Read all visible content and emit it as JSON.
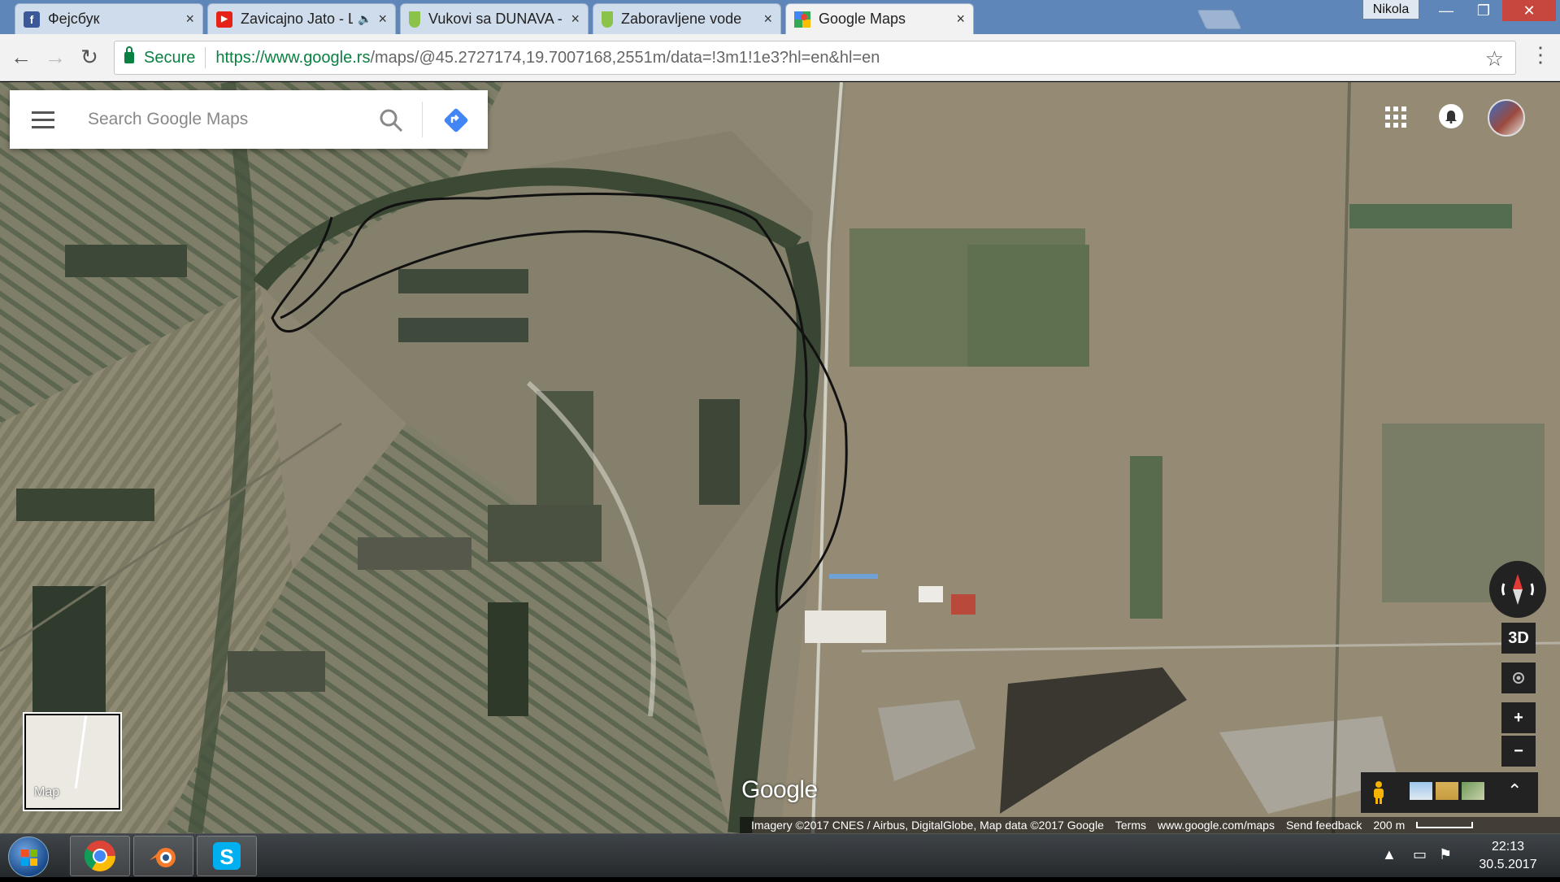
{
  "browser": {
    "tabs": [
      {
        "title": "Фејсбук",
        "favicon": "facebook-icon",
        "color": "#3b5998",
        "letter": "f",
        "audio": false
      },
      {
        "title": "Zavicajno Jato - Lipa S",
        "favicon": "youtube-icon",
        "color": "#e62117",
        "letter": "▶",
        "audio": true
      },
      {
        "title": "Vukovi sa DUNAVA - poc",
        "favicon": "forum-icon",
        "color": "#8bc34a",
        "letter": "",
        "audio": false
      },
      {
        "title": "Zaboravljene vode",
        "favicon": "forum-icon",
        "color": "#8bc34a",
        "letter": "",
        "audio": false
      },
      {
        "title": "Google Maps",
        "favicon": "google-maps-icon",
        "color": "#34a853",
        "letter": "",
        "audio": false
      }
    ],
    "close_glyph": "×",
    "profile_name": "Nikola",
    "window": {
      "minimize": "—",
      "maximize": "❐",
      "close": "✕"
    },
    "secure_label": "Secure",
    "url_host": "https://www.google.rs",
    "url_path": "/maps/@45.2727174,19.7007168,2551m/data=!3m1!1e3?hl=en&hl=en",
    "star_glyph": "☆",
    "menu_glyph": "⋮"
  },
  "maps": {
    "search_placeholder": "Search Google Maps",
    "minimap_label": "Map",
    "logo_text": "Google",
    "btn_3d": "3D",
    "zoom_in": "+",
    "zoom_out": "−",
    "expand": "⌃",
    "attribution": "Imagery ©2017 CNES / Airbus, DigitalGlobe, Map data ©2017 Google",
    "terms": "Terms",
    "site": "www.google.com/maps",
    "feedback": "Send feedback",
    "scale": "200 m"
  },
  "taskbar": {
    "apps": [
      "chrome-icon",
      "blender-icon",
      "skype-icon"
    ],
    "time": "22:13",
    "date": "30.5.2017"
  }
}
